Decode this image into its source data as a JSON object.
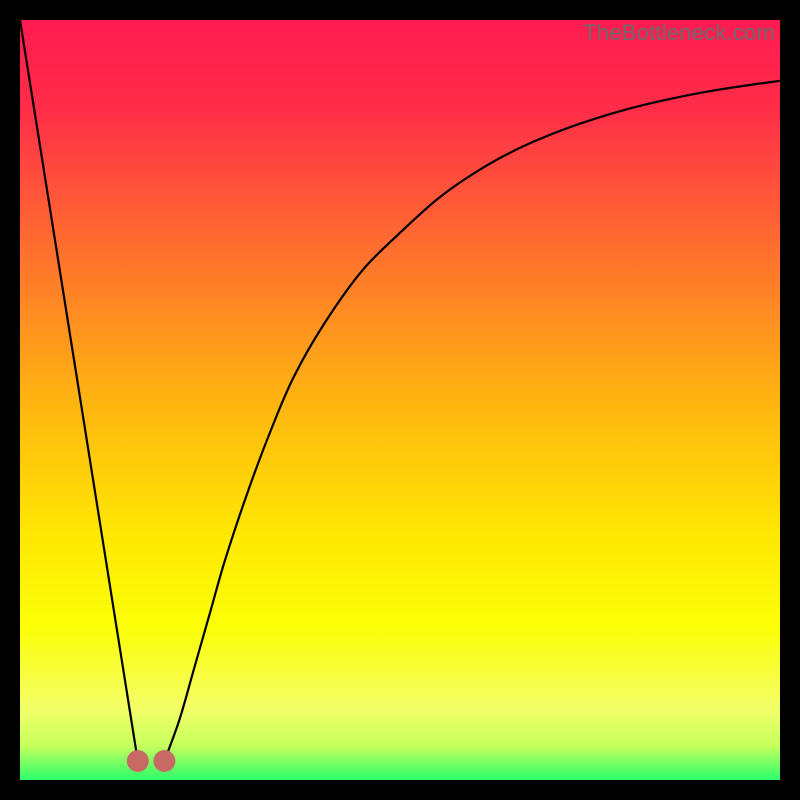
{
  "watermark": "TheBottleneck.com",
  "colors": {
    "gradient_stops": [
      {
        "offset": 0.0,
        "color": "#ff1a52"
      },
      {
        "offset": 0.12,
        "color": "#ff2e48"
      },
      {
        "offset": 0.3,
        "color": "#ff6e2f"
      },
      {
        "offset": 0.5,
        "color": "#ffb411"
      },
      {
        "offset": 0.68,
        "color": "#ffe803"
      },
      {
        "offset": 0.8,
        "color": "#fbff07"
      },
      {
        "offset": 0.905,
        "color": "#f4ff67"
      },
      {
        "offset": 0.955,
        "color": "#c6ff5e"
      },
      {
        "offset": 1.0,
        "color": "#2bff6a"
      }
    ],
    "curve": "#000000",
    "marker_fill": "#c76a64",
    "marker_stroke": "#7a3a36"
  },
  "chart_data": {
    "type": "line",
    "title": "",
    "xlabel": "",
    "ylabel": "",
    "xlim": [
      0,
      100
    ],
    "ylim": [
      0,
      100
    ],
    "series": [
      {
        "name": "left-edge",
        "x": [
          0,
          15.5
        ],
        "y": [
          100,
          2.5
        ]
      },
      {
        "name": "right-curve",
        "x": [
          19,
          21,
          23,
          25,
          27,
          30,
          33,
          36,
          40,
          45,
          50,
          55,
          60,
          65,
          70,
          75,
          80,
          85,
          90,
          95,
          100
        ],
        "y": [
          2.5,
          8,
          15,
          22,
          29,
          38,
          46,
          53,
          60,
          67,
          72,
          76.5,
          80,
          82.8,
          85,
          86.8,
          88.3,
          89.5,
          90.5,
          91.3,
          92
        ]
      }
    ],
    "markers": [
      {
        "x": 15.5,
        "y": 2.5
      },
      {
        "x": 19.0,
        "y": 2.5
      }
    ]
  }
}
